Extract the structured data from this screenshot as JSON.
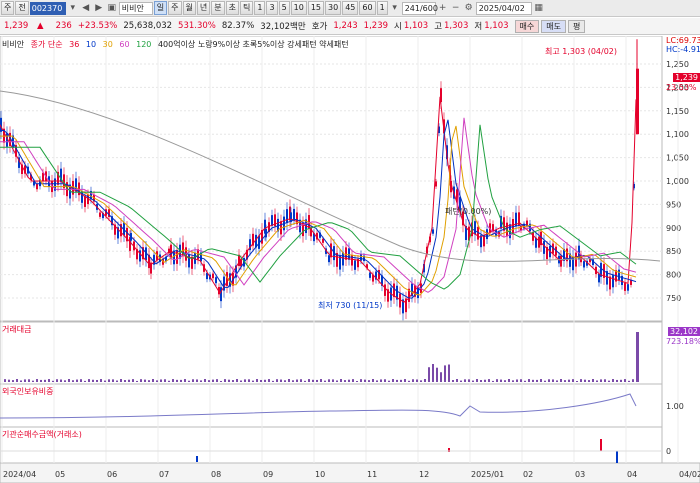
{
  "toolbar": {
    "market": "주",
    "period_type": "전",
    "code": "002370",
    "name": "비비안",
    "tabs": [
      "일",
      "주",
      "월",
      "년",
      "분",
      "초",
      "틱"
    ],
    "active_tab": "일",
    "minute_options": [
      "1",
      "3",
      "5",
      "10",
      "15",
      "30",
      "45",
      "60"
    ],
    "extra": "1",
    "count": "241/600",
    "date": "2025/04/02",
    "gear_icon": "gear-icon",
    "right_buttons": [
      "매수",
      "매도",
      "평"
    ]
  },
  "quote": {
    "price": "1,239",
    "arrow": "▲",
    "change": "236",
    "change_pct": "+23.53%",
    "volume": "25,638,032",
    "volume_pct": "531.30%",
    "ratio": "82.37%",
    "amount": "32,102백만",
    "ask_label": "호가",
    "ask": "1,243",
    "bid": "1,239",
    "open_label": "시",
    "open": "1,103",
    "high_label": "고",
    "high": "1,303",
    "low_label": "저",
    "low": "1,103",
    "buy_btn": "매수",
    "sell_btn": "매도",
    "eval_btn": "평"
  },
  "legend": {
    "name": "비비안",
    "ma_label": "종가 단순",
    "ma_periods": [
      "36",
      "10",
      "30",
      "60",
      "120"
    ],
    "ma_colors": [
      "#e4002b",
      "#0030c0",
      "#e0a000",
      "#d040c0",
      "#20a040"
    ],
    "conditions": "400억이상 노랑9%이상 초록5%이상 강세패턴  약세패턴"
  },
  "price_axis": {
    "ticks": [
      "1,250",
      "1,200",
      "1,150",
      "1,100",
      "1,050",
      "1,000",
      "950",
      "900",
      "850",
      "800",
      "750"
    ],
    "lc": "LC:69.73",
    "hc": "HC:-4.91",
    "last_tag": "1,239",
    "pct_tag": "23.53%"
  },
  "annotations": {
    "high": "최고 1,303 (04/02)",
    "low": "최저 730 (11/15)",
    "mid": "패턴(0.00%)"
  },
  "volume_panel": {
    "label": "거래대금",
    "tag1": "32,102",
    "tag2": "723.18%"
  },
  "foreign_panel": {
    "label": "외국인보유비중",
    "tick": "1.00"
  },
  "inst_panel": {
    "label": "기관순매수금액(거래소)",
    "tick": "0"
  },
  "date_axis": {
    "labels": [
      "2024/04",
      "05",
      "06",
      "07",
      "08",
      "09",
      "10",
      "11",
      "12",
      "2025/01",
      "02",
      "03",
      "04",
      "04/02"
    ]
  }
}
